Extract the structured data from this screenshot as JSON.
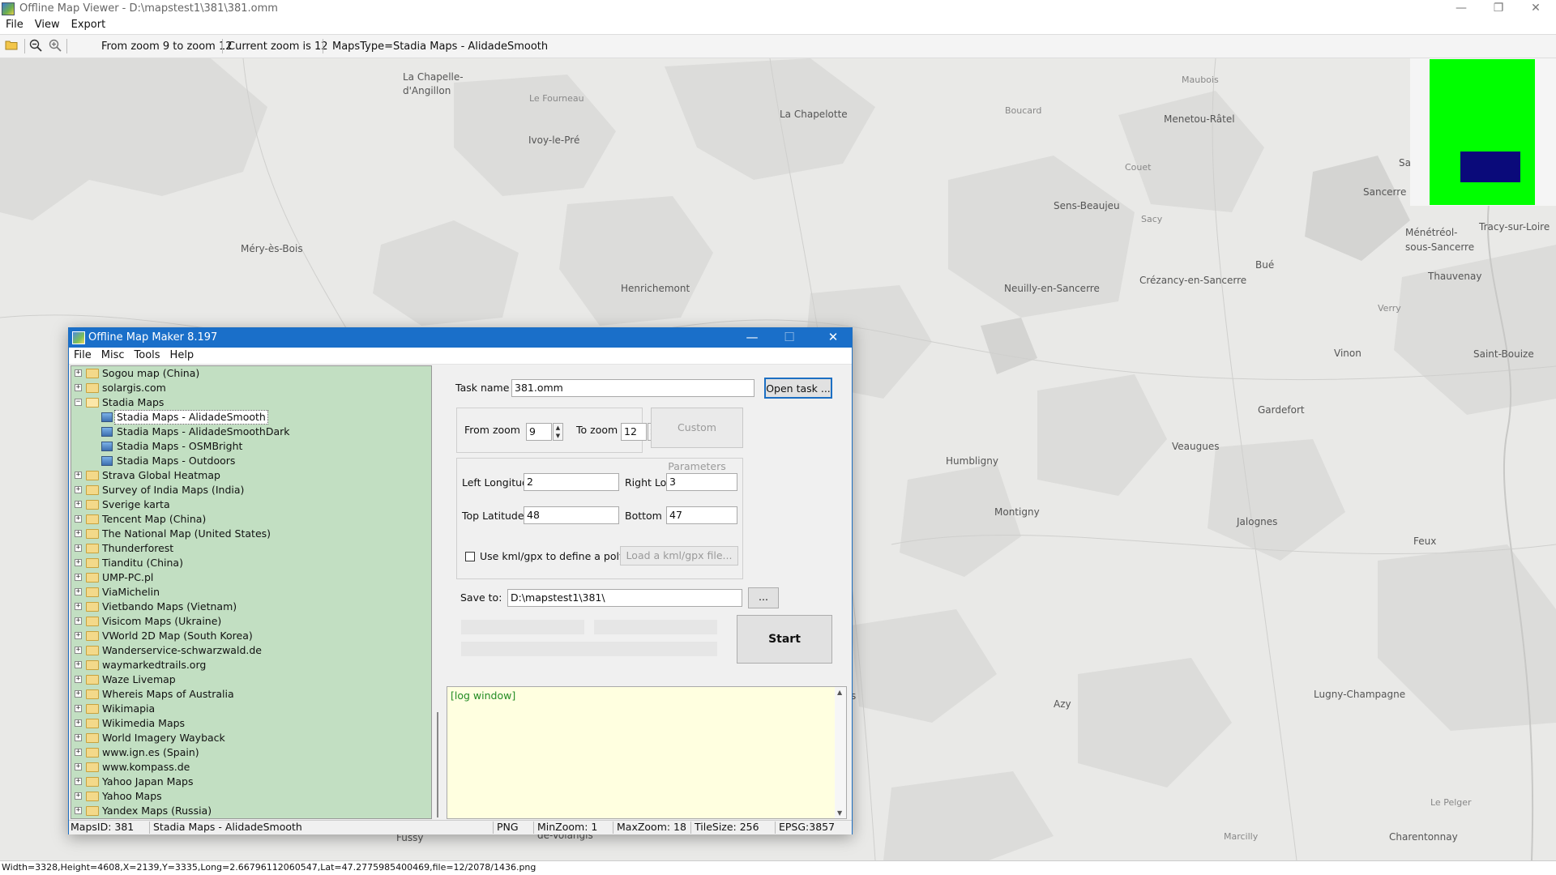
{
  "viewer": {
    "title": "Offline Map Viewer - D:\\mapstest1\\381\\381.omm",
    "menu": [
      "File",
      "View",
      "Export"
    ],
    "window_buttons": {
      "minimize": "—",
      "restore": "❐",
      "close": "✕"
    },
    "toolbar": {
      "zoom_range": "From zoom 9 to zoom 12",
      "current_zoom": "Current zoom is 12",
      "maps_type": "MapsType=Stadia Maps - AlidadeSmooth"
    },
    "status": "Width=3328,Height=4608,X=2139,Y=3335,Long=2.66796112060547,Lat=47.2775985400469,file=12/2078/1436.png"
  },
  "map": {
    "places": [
      {
        "name": "La Chapelle-",
        "cls": ""
      },
      {
        "name": "d'Angillon",
        "cls": ""
      },
      {
        "name": "Le Fourneau",
        "cls": "small"
      },
      {
        "name": "Ivoy-le-Pré",
        "cls": ""
      },
      {
        "name": "La Chapelotte",
        "cls": ""
      },
      {
        "name": "Boucard",
        "cls": "small"
      },
      {
        "name": "Maubois",
        "cls": "small"
      },
      {
        "name": "Menetou-Râtel",
        "cls": ""
      },
      {
        "name": "Couet",
        "cls": "small"
      },
      {
        "name": "Sancerre",
        "cls": ""
      },
      {
        "name": "Sens-Beaujeu",
        "cls": ""
      },
      {
        "name": "Sacy",
        "cls": "small"
      },
      {
        "name": "Ménétréol-",
        "cls": ""
      },
      {
        "name": "sous-Sancerre",
        "cls": ""
      },
      {
        "name": "Tracy-sur-Loire",
        "cls": ""
      },
      {
        "name": "Méry-ès-Bois",
        "cls": ""
      },
      {
        "name": "Henrichemont",
        "cls": ""
      },
      {
        "name": "Neuilly-en-Sancerre",
        "cls": ""
      },
      {
        "name": "Crézancy-en-Sancerre",
        "cls": ""
      },
      {
        "name": "Bué",
        "cls": ""
      },
      {
        "name": "Thauvenay",
        "cls": ""
      },
      {
        "name": "Verry",
        "cls": "small"
      },
      {
        "name": "Vinon",
        "cls": ""
      },
      {
        "name": "Saint-Bouize",
        "cls": ""
      },
      {
        "name": "Gardefort",
        "cls": ""
      },
      {
        "name": "Veaugues",
        "cls": ""
      },
      {
        "name": "Humbligny",
        "cls": ""
      },
      {
        "name": "Montigny",
        "cls": ""
      },
      {
        "name": "Jalognes",
        "cls": ""
      },
      {
        "name": "Feux",
        "cls": ""
      },
      {
        "name": "Azy",
        "cls": ""
      },
      {
        "name": "Lugny-Champagne",
        "cls": ""
      },
      {
        "name": "Le Pelger",
        "cls": "small"
      },
      {
        "name": "Marcilly",
        "cls": "small"
      },
      {
        "name": "Charentonnay",
        "cls": ""
      },
      {
        "name": "Fussy",
        "cls": ""
      },
      {
        "name": "de-Volangis",
        "cls": ""
      },
      {
        "name": "Sa",
        "cls": ""
      },
      {
        "name": "s",
        "cls": ""
      }
    ],
    "overview_colors": {
      "background": "#00ff00",
      "viewport": "#0a0a7a"
    }
  },
  "dialog": {
    "title": "Offline Map Maker 8.197",
    "menu": [
      "File",
      "Misc",
      "Tools",
      "Help"
    ],
    "tree": [
      {
        "label": "Sogou map (China)",
        "type": "folder"
      },
      {
        "label": "solargis.com",
        "type": "folder"
      },
      {
        "label": "Stadia Maps",
        "type": "folder-open"
      },
      {
        "label": "Stadia Maps - AlidadeSmooth",
        "type": "leaf",
        "selected": true
      },
      {
        "label": "Stadia Maps - AlidadeSmoothDark",
        "type": "leaf"
      },
      {
        "label": "Stadia Maps - OSMBright",
        "type": "leaf"
      },
      {
        "label": "Stadia Maps - Outdoors",
        "type": "leaf"
      },
      {
        "label": "Strava Global Heatmap",
        "type": "folder"
      },
      {
        "label": "Survey of India Maps (India)",
        "type": "folder"
      },
      {
        "label": "Sverige karta",
        "type": "folder"
      },
      {
        "label": "Tencent Map (China)",
        "type": "folder"
      },
      {
        "label": "The National Map (United States)",
        "type": "folder"
      },
      {
        "label": "Thunderforest",
        "type": "folder"
      },
      {
        "label": "Tianditu (China)",
        "type": "folder"
      },
      {
        "label": "UMP-PC.pl",
        "type": "folder"
      },
      {
        "label": "ViaMichelin",
        "type": "folder"
      },
      {
        "label": "Vietbando Maps (Vietnam)",
        "type": "folder"
      },
      {
        "label": "Visicom Maps (Ukraine)",
        "type": "folder"
      },
      {
        "label": "VWorld 2D Map (South Korea)",
        "type": "folder"
      },
      {
        "label": "Wanderservice-schwarzwald.de",
        "type": "folder"
      },
      {
        "label": "waymarkedtrails.org",
        "type": "folder"
      },
      {
        "label": "Waze Livemap",
        "type": "folder"
      },
      {
        "label": "Whereis Maps of Australia",
        "type": "folder"
      },
      {
        "label": "Wikimapia",
        "type": "folder"
      },
      {
        "label": "Wikimedia Maps",
        "type": "folder"
      },
      {
        "label": "World Imagery Wayback",
        "type": "folder"
      },
      {
        "label": "www.ign.es (Spain)",
        "type": "folder"
      },
      {
        "label": "www.kompass.de",
        "type": "folder"
      },
      {
        "label": "Yahoo Japan Maps",
        "type": "folder"
      },
      {
        "label": "Yahoo Maps",
        "type": "folder"
      },
      {
        "label": "Yandex Maps (Russia)",
        "type": "folder"
      }
    ],
    "task_name_label": "Task name",
    "task_name_value": "381.omm",
    "open_task_label": "Open task ...",
    "from_zoom_label": "From zoom",
    "from_zoom_value": "9",
    "to_zoom_label": "To zoom",
    "to_zoom_value": "12",
    "custom_params_label": "Custom Parameters",
    "left_lon_label": "Left Longitude",
    "left_lon_value": "2",
    "right_lon_label": "Right Longitude",
    "right_lon_value": "3",
    "top_lat_label": "Top Latitude",
    "top_lat_value": "48",
    "bottom_lat_label": "Bottom Latitude",
    "bottom_lat_value": "47",
    "kml_checkbox_label": "Use kml/gpx to define a polygon area",
    "load_kml_label": "Load a kml/gpx file...",
    "save_to_label": "Save to:",
    "save_to_value": "D:\\mapstest1\\381\\",
    "browse_label": "...",
    "start_label": "Start",
    "log_text": "[log window]",
    "status": {
      "maps_id": "MapsID: 381",
      "maps_name": "Stadia Maps - AlidadeSmooth",
      "format": "PNG",
      "min_zoom": "MinZoom: 1",
      "max_zoom": "MaxZoom: 18",
      "tile_size": "TileSize: 256",
      "epsg": "EPSG:3857"
    }
  }
}
